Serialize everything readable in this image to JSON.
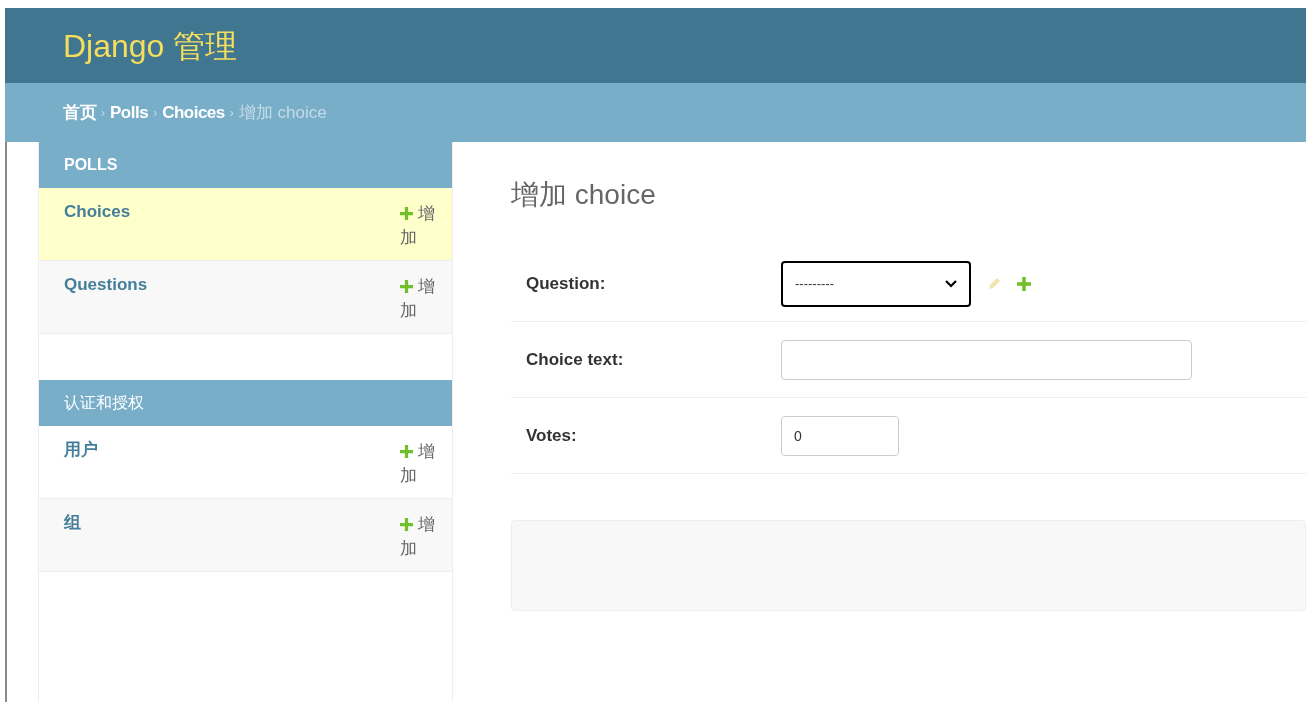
{
  "header": {
    "title": "Django 管理"
  },
  "breadcrumb_separator": "›",
  "breadcrumbs": [
    {
      "label": "首页",
      "link": true
    },
    {
      "label": "Polls",
      "link": true
    },
    {
      "label": "Choices",
      "link": true
    },
    {
      "label": "增加 choice",
      "link": false
    }
  ],
  "sidebar": [
    {
      "caption": "POLLS",
      "models": [
        {
          "name": "Choices",
          "add": "增加",
          "selected": true
        },
        {
          "name": "Questions",
          "add": "增加",
          "selected": false
        }
      ]
    },
    {
      "caption": "认证和授权",
      "models": [
        {
          "name": "用户",
          "add": "增加",
          "selected": false
        },
        {
          "name": "组",
          "add": "增加",
          "selected": false
        }
      ]
    }
  ],
  "page_title": "增加 choice",
  "fields": [
    {
      "label": "Question:",
      "kind": "select",
      "value": "---------",
      "focused": true
    },
    {
      "label": "Choice text:",
      "kind": "text",
      "focused": false
    },
    {
      "label": "Votes:",
      "kind": "number",
      "value": "0",
      "focused": false
    }
  ]
}
